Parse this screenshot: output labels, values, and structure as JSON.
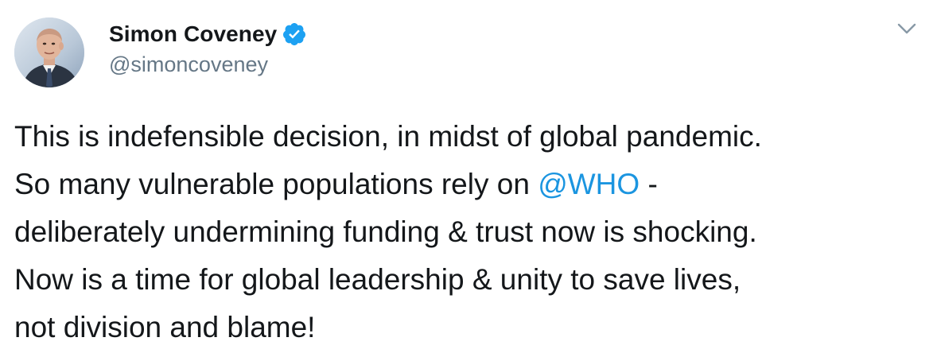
{
  "author": {
    "display_name": "Simon Coveney",
    "handle": "@simoncoveney",
    "verified": true,
    "avatar_icon": "profile-photo"
  },
  "menu": {
    "icon": "chevron-down-icon"
  },
  "tweet": {
    "text_part1": "This is indefensible decision, in midst of global pandemic.\nSo many vulnerable populations rely on ",
    "mention": "@WHO",
    "text_part2": " -\ndeliberately undermining funding & trust now is shocking.\nNow is a time for global leadership & unity to save lives,\nnot division and blame!"
  },
  "colors": {
    "text": "#14171a",
    "secondary": "#657786",
    "accent": "#1b95e0",
    "verified_badge": "#1da1f2"
  }
}
